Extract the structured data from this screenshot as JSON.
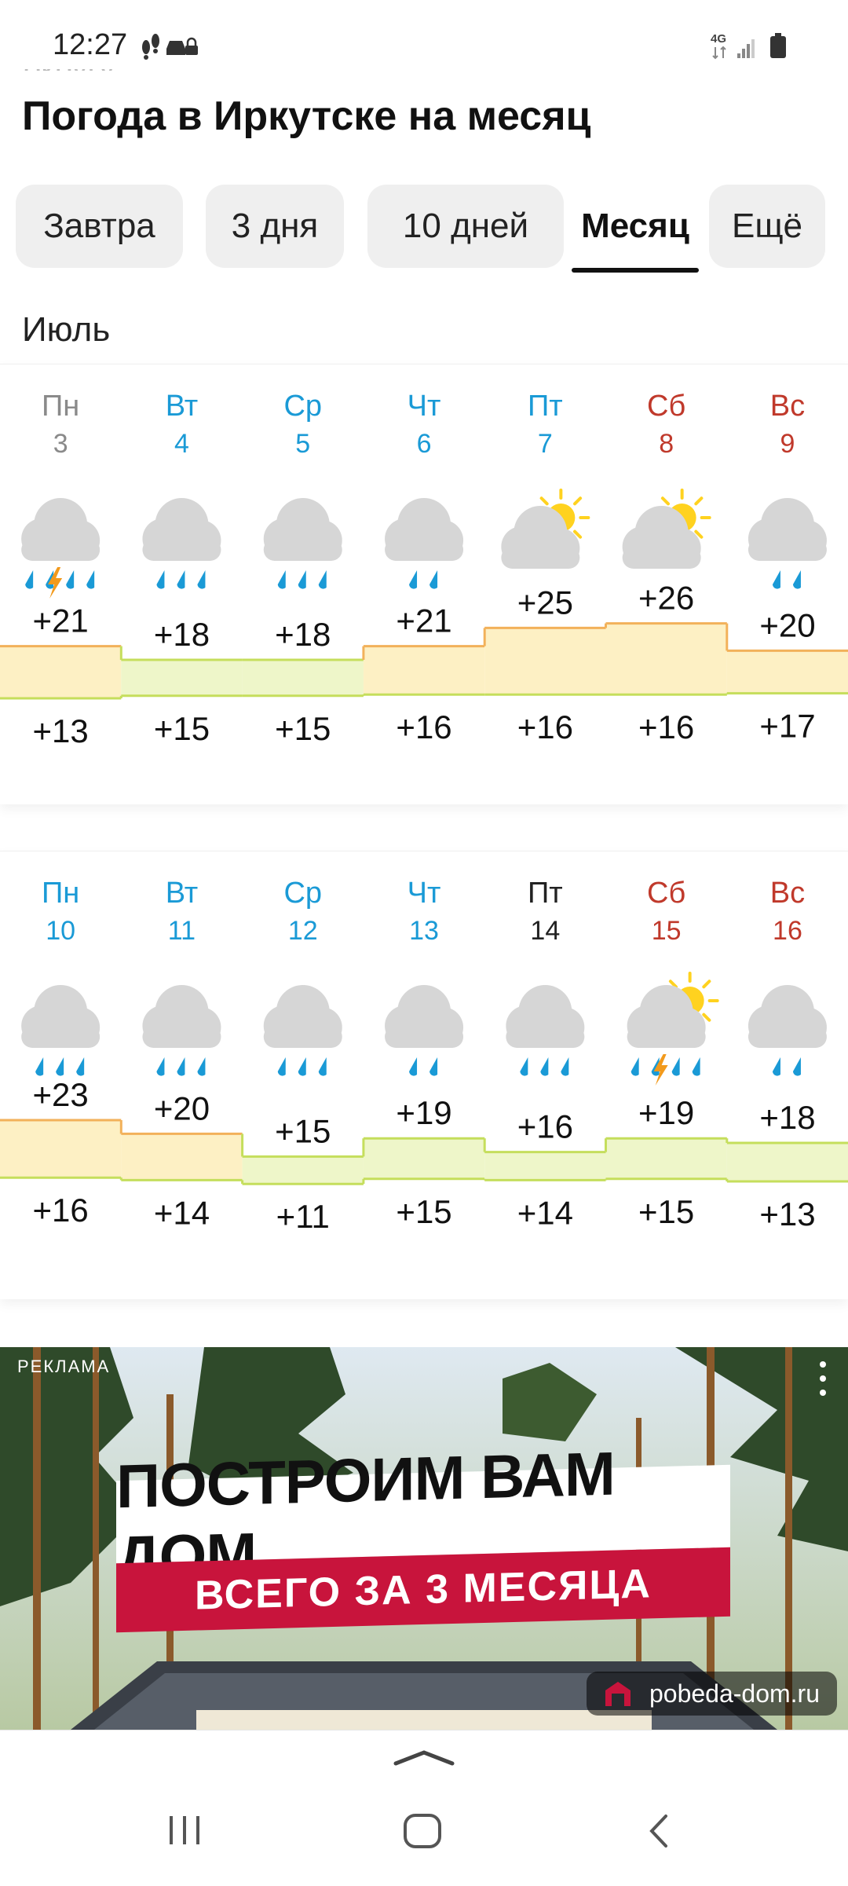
{
  "status_bar": {
    "time": "12:27",
    "network": "4G"
  },
  "header": {
    "cut_text": "округу",
    "title": "Погода в Иркутске на месяц"
  },
  "tabs": [
    {
      "label": "Завтра",
      "active": false
    },
    {
      "label": "3 дня",
      "active": false
    },
    {
      "label": "10 дней",
      "active": false
    },
    {
      "label": "Месяц",
      "active": true
    },
    {
      "label": "Ещё",
      "active": false
    }
  ],
  "month": "Июль",
  "weeks": [
    {
      "days": [
        {
          "dow": "Пн",
          "date": "3",
          "kind": "past",
          "icon": "cloud-thunderstorm-icon",
          "hi": "+21",
          "lo": "+13"
        },
        {
          "dow": "Вт",
          "date": "4",
          "kind": "weekday",
          "icon": "cloud-heavy-rain-icon",
          "hi": "+18",
          "lo": "+15"
        },
        {
          "dow": "Ср",
          "date": "5",
          "kind": "weekday",
          "icon": "cloud-heavy-rain-icon",
          "hi": "+18",
          "lo": "+15"
        },
        {
          "dow": "Чт",
          "date": "6",
          "kind": "weekday",
          "icon": "cloud-rain-icon",
          "hi": "+21",
          "lo": "+16"
        },
        {
          "dow": "Пт",
          "date": "7",
          "kind": "weekday",
          "icon": "partly-cloudy-icon",
          "hi": "+25",
          "lo": "+16"
        },
        {
          "dow": "Сб",
          "date": "8",
          "kind": "weekend",
          "icon": "partly-cloudy-icon",
          "hi": "+26",
          "lo": "+16"
        },
        {
          "dow": "Вс",
          "date": "9",
          "kind": "weekend",
          "icon": "cloud-rain-icon",
          "hi": "+20",
          "lo": "+17"
        }
      ]
    },
    {
      "days": [
        {
          "dow": "Пн",
          "date": "10",
          "kind": "weekday",
          "icon": "cloud-heavy-rain-icon",
          "hi": "+23",
          "lo": "+16"
        },
        {
          "dow": "Вт",
          "date": "11",
          "kind": "weekday",
          "icon": "cloud-heavy-rain-icon",
          "hi": "+20",
          "lo": "+14"
        },
        {
          "dow": "Ср",
          "date": "12",
          "kind": "weekday",
          "icon": "cloud-heavy-rain-icon",
          "hi": "+15",
          "lo": "+11"
        },
        {
          "dow": "Чт",
          "date": "13",
          "kind": "weekday",
          "icon": "cloud-rain-icon",
          "hi": "+19",
          "lo": "+15"
        },
        {
          "dow": "Пт",
          "date": "14",
          "kind": "today",
          "icon": "cloud-heavy-rain-icon",
          "hi": "+16",
          "lo": "+14"
        },
        {
          "dow": "Сб",
          "date": "15",
          "kind": "weekend",
          "icon": "sun-thunderstorm-icon",
          "hi": "+19",
          "lo": "+15"
        },
        {
          "dow": "Вс",
          "date": "16",
          "kind": "weekend",
          "icon": "cloud-rain-icon",
          "hi": "+18",
          "lo": "+13"
        }
      ]
    }
  ],
  "colors": {
    "weekday": "#1a9ad6",
    "weekend": "#c0392b",
    "past": "#8a8a8a",
    "today": "#222222",
    "warm_fill": "#fdf0c4",
    "cool_fill": "#eef6c9",
    "warm_line": "#f2b15a",
    "cool_line": "#c5de5c"
  },
  "ad": {
    "label": "РЕКЛАМА",
    "headline": "ПОСТРОИМ ВАМ ДОМ",
    "subheadline": "ВСЕГО ЗА 3 МЕСЯЦА",
    "domain": "pobeda-dom.ru"
  }
}
